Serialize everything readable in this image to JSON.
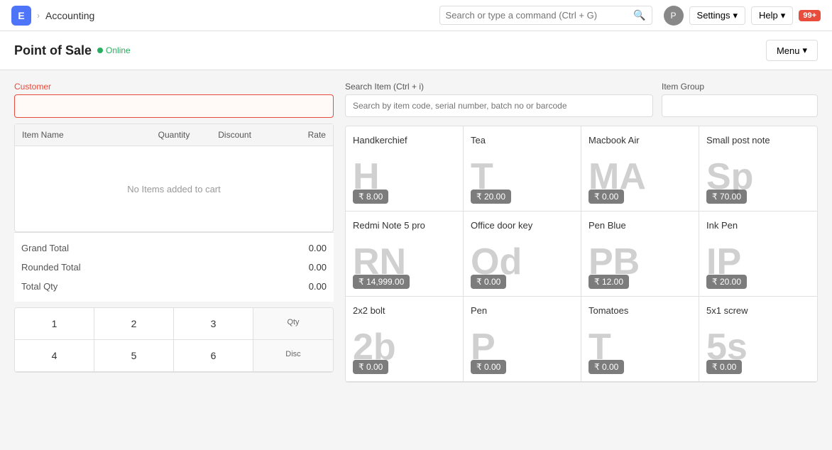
{
  "navbar": {
    "app_icon": "E",
    "app_icon_color": "#4e74f9",
    "breadcrumb_separator": "›",
    "section_title": "Accounting",
    "search_placeholder": "Search or type a command (Ctrl + G)",
    "avatar_label": "P",
    "settings_label": "Settings",
    "help_label": "Help",
    "notification_count": "99+",
    "chevron_down": "▾"
  },
  "sub_header": {
    "page_title": "Point of Sale",
    "status": "Online",
    "menu_label": "Menu",
    "chevron_down": "▾"
  },
  "left_panel": {
    "customer_label": "Customer",
    "customer_placeholder": "",
    "table_headers": [
      "Item Name",
      "Quantity",
      "Discount",
      "Rate"
    ],
    "cart_empty_message": "No Items added to cart",
    "grand_total_label": "Grand Total",
    "grand_total_value": "0.00",
    "rounded_total_label": "Rounded Total",
    "rounded_total_value": "0.00",
    "total_qty_label": "Total Qty",
    "total_qty_value": "0.00",
    "numpad_keys": [
      "1",
      "2",
      "3",
      "Qty",
      "4",
      "5",
      "6",
      "Disc"
    ]
  },
  "right_panel": {
    "search_item_label": "Search Item (Ctrl + i)",
    "search_item_placeholder": "Search by item code, serial number, batch no or barcode",
    "item_group_label": "Item Group",
    "item_group_placeholder": "",
    "products": [
      {
        "name": "Handkerchief",
        "abbr": "H",
        "price": "₹ 8.00"
      },
      {
        "name": "Tea",
        "abbr": "T",
        "price": "₹ 20.00"
      },
      {
        "name": "Macbook Air",
        "abbr": "MA",
        "price": "₹ 0.00"
      },
      {
        "name": "Small post note",
        "abbr": "Sp",
        "price": "₹ 70.00"
      },
      {
        "name": "Redmi Note 5 pro",
        "abbr": "RN",
        "price": "₹ 14,999.00"
      },
      {
        "name": "Office door key",
        "abbr": "Od",
        "price": "₹ 0.00"
      },
      {
        "name": "Pen Blue",
        "abbr": "PB",
        "price": "₹ 12.00"
      },
      {
        "name": "Ink Pen",
        "abbr": "IP",
        "price": "₹ 20.00"
      },
      {
        "name": "2x2 bolt",
        "abbr": "2b",
        "price": "₹ 0.00"
      },
      {
        "name": "Pen",
        "abbr": "P",
        "price": "₹ 0.00"
      },
      {
        "name": "Tomatoes",
        "abbr": "T",
        "price": "₹ 0.00"
      },
      {
        "name": "5x1 screw",
        "abbr": "5s",
        "price": "₹ 0.00"
      }
    ]
  }
}
